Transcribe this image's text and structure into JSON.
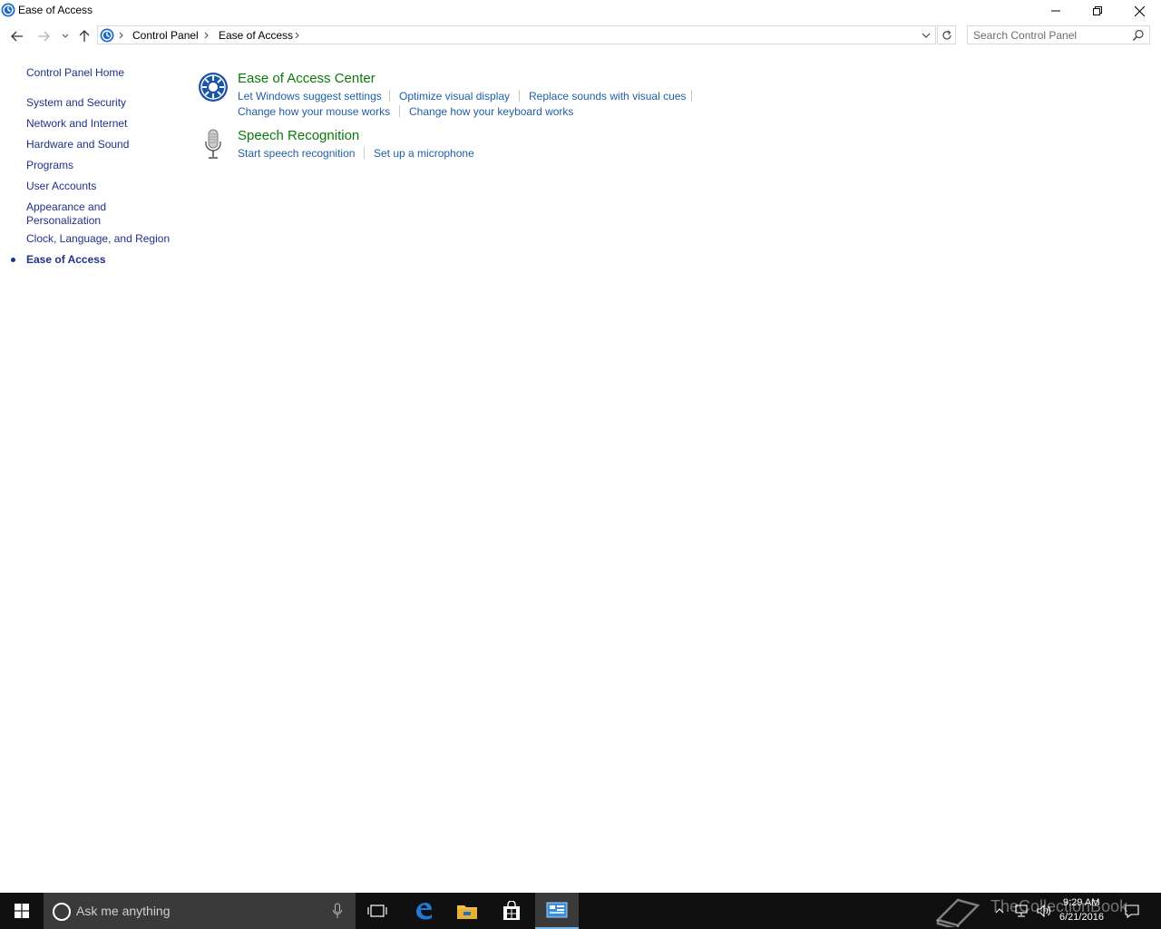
{
  "window": {
    "title": "Ease of Access"
  },
  "address_bar": {
    "crumbs": [
      "Control Panel",
      "Ease of Access"
    ]
  },
  "search": {
    "placeholder": "Search Control Panel"
  },
  "sidebar": {
    "items": [
      {
        "label": "Control Panel Home"
      },
      {
        "label": "System and Security"
      },
      {
        "label": "Network and Internet"
      },
      {
        "label": "Hardware and Sound"
      },
      {
        "label": "Programs"
      },
      {
        "label": "User Accounts"
      },
      {
        "label": "Appearance and",
        "label2": "Personalization"
      },
      {
        "label": "Clock, Language, and Region"
      },
      {
        "label": "Ease of Access",
        "active": true
      }
    ]
  },
  "categories": [
    {
      "title": "Ease of Access Center",
      "icon": "ease-of-access-icon",
      "links": [
        "Let Windows suggest settings",
        "Optimize visual display",
        "Replace sounds with visual cues",
        "Change how your mouse works",
        "Change how your keyboard works"
      ]
    },
    {
      "title": "Speech Recognition",
      "icon": "microphone-icon",
      "links": [
        "Start speech recognition",
        "Set up a microphone"
      ]
    }
  ],
  "taskbar": {
    "search_placeholder": "Ask me anything",
    "apps": [
      "task-view-icon",
      "edge-icon",
      "file-explorer-icon",
      "store-icon",
      "control-panel-icon"
    ],
    "time": "9:29 AM",
    "date": "6/21/2016",
    "watermark": "TheCollectionBook"
  },
  "colors": {
    "link": "#1f5fa6",
    "category_title": "#0a7a0a",
    "sidebar_link": "#1e3287",
    "taskbar": "#101010"
  }
}
